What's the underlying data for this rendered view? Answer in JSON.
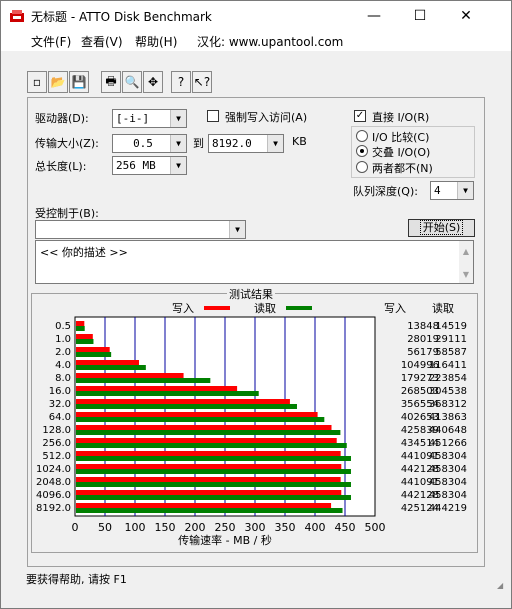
{
  "window": {
    "title": "无标题 - ATTO Disk Benchmark",
    "minimize": "—",
    "maximize": "☐",
    "close": "✕"
  },
  "menu": {
    "file": "文件(F)",
    "view": "查看(V)",
    "help": "帮助(H)",
    "localized": "汉化: www.upantool.com"
  },
  "toolbar": {
    "icons": [
      "new-icon",
      "open-icon",
      "save-icon",
      "print-icon",
      "print-preview-icon",
      "move-icon",
      "help-icon",
      "context-help-icon"
    ],
    "glyphs": [
      "▫",
      "📂",
      "💾",
      "🖶",
      "🔍",
      "✥",
      "?",
      "↖?"
    ]
  },
  "settings": {
    "drive_label": "驱动器(D):",
    "drive_value": "[-i-]",
    "force_write_label": "强制写入访问(A)",
    "direct_io_label": "直接 I/O(R)",
    "transfer_label": "传输大小(Z):",
    "transfer_from": "0.5",
    "to_label": "到",
    "transfer_to": "8192.0",
    "unit": "KB",
    "io_compare_label": "I/O 比较(C)",
    "overlap_io_label": "交叠 I/O(O)",
    "neither_label": "两者都不(N)",
    "total_length_label": "总长度(L):",
    "total_length_value": "256 MB",
    "queue_depth_label": "队列深度(Q):",
    "queue_depth_value": "4",
    "controlled_by_label": "受控制于(B):",
    "controlled_by_value": "",
    "start_button": "开始(S)",
    "description": "<<  你的描述   >>"
  },
  "results": {
    "heading": "测试结果",
    "write_legend": "写入",
    "read_legend": "读取",
    "col_write": "写入",
    "col_read": "读取",
    "xlabel": "传输速率 - MB / 秒",
    "x_ticks": [
      "0",
      "50",
      "100",
      "150",
      "200",
      "250",
      "300",
      "350",
      "400",
      "450",
      "500"
    ]
  },
  "chart_data": {
    "type": "bar",
    "title": "测试结果",
    "xlabel": "传输速率 - MB / 秒",
    "ylabel": "",
    "xlim": [
      0,
      500
    ],
    "categories": [
      "0.5",
      "1.0",
      "2.0",
      "4.0",
      "8.0",
      "16.0",
      "32.0",
      "64.0",
      "128.0",
      "256.0",
      "512.0",
      "1024.0",
      "2048.0",
      "4096.0",
      "8192.0"
    ],
    "series": [
      {
        "name": "写入",
        "color": "#ff0000",
        "values": [
          13848,
          28019,
          56179,
          104996,
          179273,
          268503,
          356554,
          402653,
          425839,
          434514,
          441091,
          442128,
          441091,
          442128,
          425124
        ]
      },
      {
        "name": "读取",
        "color": "#008000",
        "values": [
          14519,
          29111,
          58587,
          116411,
          223854,
          304538,
          368312,
          413863,
          440648,
          451266,
          458304,
          458304,
          458304,
          458304,
          444219
        ]
      }
    ],
    "grid": true,
    "legend": "top-center"
  },
  "status": {
    "text": "要获得帮助, 请按 F1"
  }
}
